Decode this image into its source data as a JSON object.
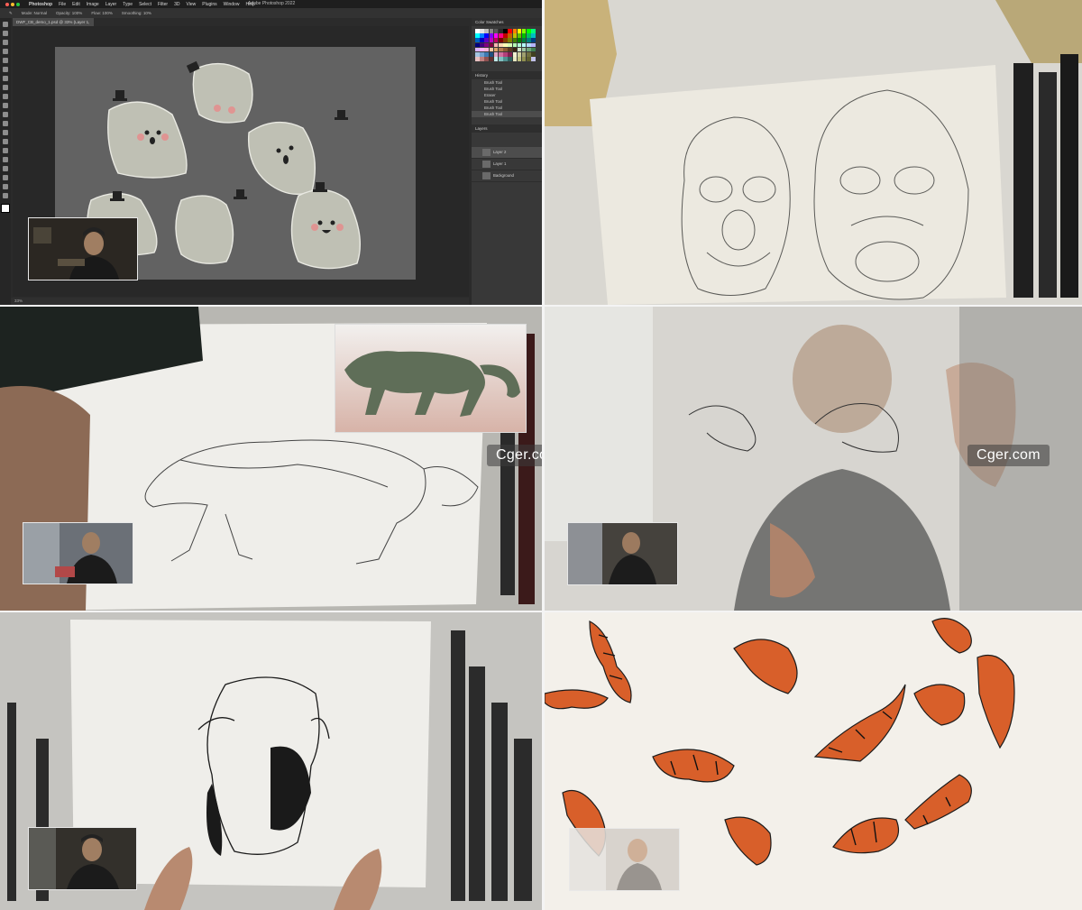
{
  "photoshop": {
    "app_name": "Photoshop",
    "menu_items": [
      "File",
      "Edit",
      "Image",
      "Layer",
      "Type",
      "Select",
      "Filter",
      "3D",
      "View",
      "Plugins",
      "Window",
      "Help"
    ],
    "window_title": "Adobe Photoshop 2022",
    "options": [
      "Mode: Normal",
      "Opacity: 100%",
      "Flow: 100%",
      "Smoothing: 10%"
    ],
    "doc_tab": "DWF_CB_demo_1.psd @ 33% (Layer 1, RGB/8)",
    "status": "33%",
    "panels": {
      "color_header": "Color   Swatches",
      "history_header": "History",
      "history_items": [
        "Brush Tool",
        "Brush Tool",
        "Eraser",
        "Brush Tool",
        "Brush Tool",
        "Brush Tool"
      ],
      "layers_header": "Layers",
      "layers": [
        "Layer 2",
        "Layer 1",
        "Background"
      ]
    },
    "swatch_colors": [
      "#ffffff",
      "#e6e6e6",
      "#bdbdbd",
      "#8a8a8a",
      "#5a5a5a",
      "#2a2a2a",
      "#000000",
      "#ff0000",
      "#ff8000",
      "#ffff00",
      "#80ff00",
      "#00ff00",
      "#00ff80",
      "#00ffff",
      "#0080ff",
      "#0000ff",
      "#8000ff",
      "#ff00ff",
      "#ff0080",
      "#c00000",
      "#c06000",
      "#c0c000",
      "#60c000",
      "#00c000",
      "#00c060",
      "#00c0c0",
      "#0060c0",
      "#0000c0",
      "#6000c0",
      "#c000c0",
      "#c00060",
      "#800000",
      "#804000",
      "#808000",
      "#408000",
      "#008000",
      "#008040",
      "#008080",
      "#004080",
      "#000080",
      "#400080",
      "#800080",
      "#800040",
      "#ffb3b3",
      "#ffd9b3",
      "#ffffb3",
      "#d9ffb3",
      "#b3ffb3",
      "#b3ffd9",
      "#b3ffff",
      "#b3d9ff",
      "#b3b3ff",
      "#d9b3ff",
      "#ffb3ff",
      "#ffb3d9",
      "#f2c6a0",
      "#d9a066",
      "#b37b4d",
      "#8a5a33",
      "#5c3a1f",
      "#3b2410",
      "#cfe3c9",
      "#9fc6a4",
      "#6fa37a",
      "#3f7f52",
      "#a3c4e0",
      "#6f9fcf",
      "#3f7ab3",
      "#1f4f80",
      "#e0a3c4",
      "#cf6f9f",
      "#b33f7a",
      "#801f4f",
      "#f0f0d0",
      "#d0d0a0",
      "#a0a070",
      "#707040",
      "#404020",
      "#e8c0c0",
      "#c08080",
      "#905050",
      "#603030",
      "#c0e8e8",
      "#80c0c0",
      "#509090",
      "#306060",
      "#e8e8c0",
      "#c0c080",
      "#909050",
      "#606030",
      "#c0c0e8"
    ]
  },
  "watermarks": [
    "Cger.com",
    "Cger.com"
  ]
}
